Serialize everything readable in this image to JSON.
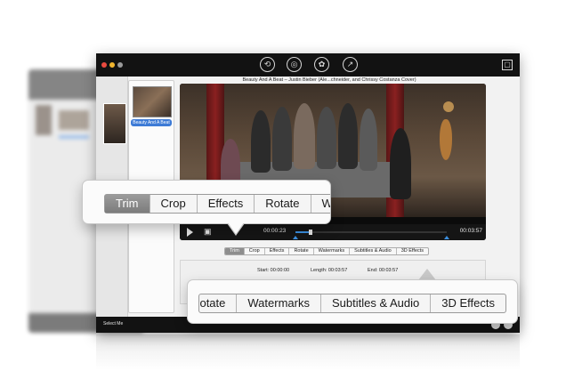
{
  "window": {
    "toolbar_icons": [
      "convert-icon",
      "dvd-icon",
      "film-reel-icon",
      "share-icon"
    ],
    "right_icon": "box-icon"
  },
  "file_list": {
    "items": [
      {
        "label": "Beauty And A Beat"
      }
    ]
  },
  "player": {
    "title": "Beauty And A Beat – Justin Bieber (Ale...chneider, and Chrissy Costanza Cover)",
    "current_time": "00:00:23",
    "total_time": "00:03:57",
    "progress": 0.1
  },
  "edit_tabs": [
    "Trim",
    "Crop",
    "Effects",
    "Rotate",
    "Watermarks",
    "Subtitles & Audio",
    "3D Effects"
  ],
  "active_tab": "Trim",
  "trim": {
    "start": "Start: 00:00:00",
    "length": "Length: 00:03:57",
    "end": "End: 00:03:57"
  },
  "bottom_bar": {
    "label": "Select Me"
  },
  "callout_1": {
    "tabs": [
      "Trim",
      "Crop",
      "Effects",
      "Rotate",
      "W"
    ]
  },
  "callout_2": {
    "tabs": [
      "otate",
      "Watermarks",
      "Subtitles & Audio",
      "3D Effects"
    ]
  },
  "colors": {
    "accent": "#3b8fe0",
    "title_bar": "#121212",
    "active_tab": "#8e8e8e"
  }
}
